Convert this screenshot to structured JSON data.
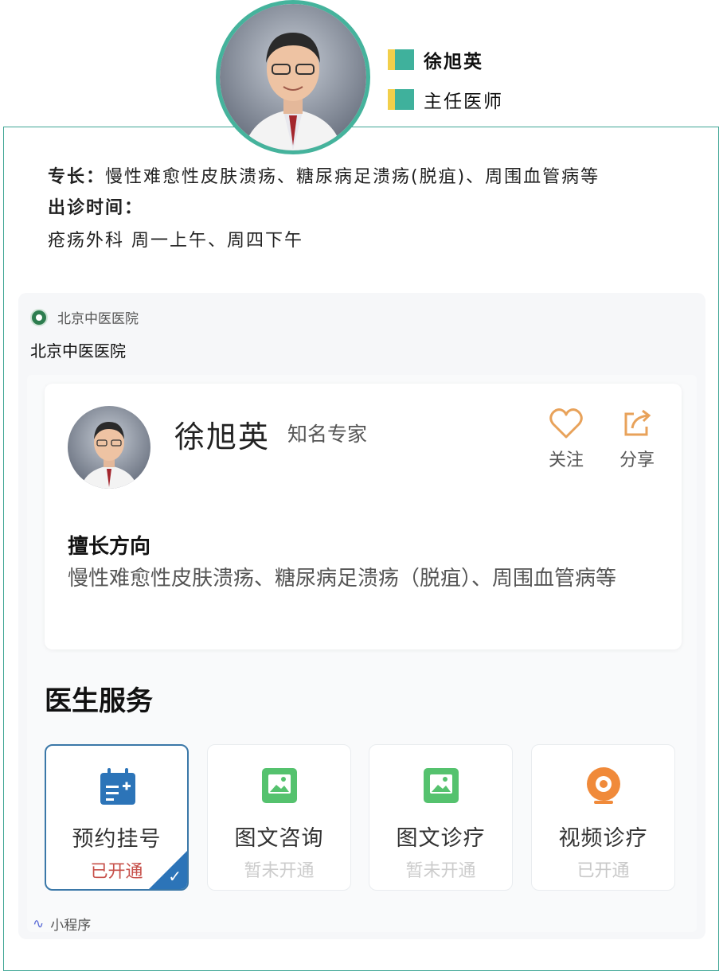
{
  "header": {
    "name": "徐旭英",
    "title": "主任医师"
  },
  "intro": {
    "specialty_label": "专长：",
    "specialty_text": "慢性难愈性皮肤溃疡、糖尿病足溃疡(脱疽)、周围血管病等",
    "hours_label": "出诊时间：",
    "hours_text": "疮疡外科 周一上午、周四下午"
  },
  "mini_program": {
    "source_name": "北京中医医院",
    "title": "北京中医医院",
    "footer": "小程序",
    "doctor": {
      "name": "徐旭英",
      "badge": "知名专家",
      "follow_label": "关注",
      "share_label": "分享",
      "specialty_heading": "擅长方向",
      "specialty_text": "慢性难愈性皮肤溃疡、糖尿病足溃疡（脱疽）、周围血管病等"
    },
    "services_heading": "医生服务",
    "services": [
      {
        "name": "预约挂号",
        "status": "已开通",
        "icon": "calendar-icon"
      },
      {
        "name": "图文咨询",
        "status": "暂未开通",
        "icon": "image-icon"
      },
      {
        "name": "图文诊疗",
        "status": "暂未开通",
        "icon": "image-icon"
      },
      {
        "name": "视频诊疗",
        "status": "已开通",
        "icon": "camera-icon"
      }
    ]
  },
  "colors": {
    "teal": "#3fb19c",
    "yellow": "#f2cf4a",
    "accent_blue": "#2c74b8",
    "status_red": "#c7504a"
  }
}
